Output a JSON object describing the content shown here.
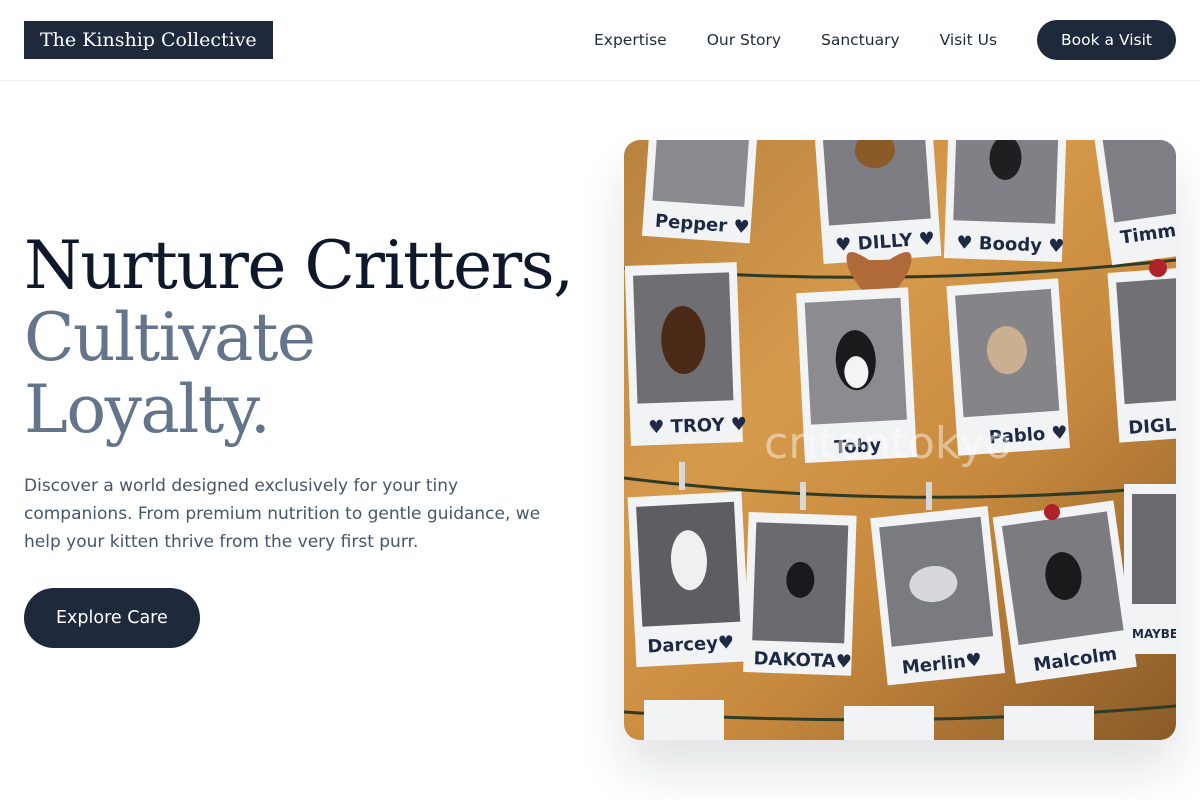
{
  "header": {
    "logo": "The Kinship Collective",
    "nav": [
      "Expertise",
      "Our Story",
      "Sanctuary",
      "Visit Us"
    ],
    "cta": "Book a Visit"
  },
  "hero": {
    "title_line1": "Nurture Critters,",
    "title_line2": "Cultivate",
    "title_line3": "Loyalty.",
    "description": "Discover a world designed exclusively for your tiny companions. From premium nutrition to gentle guidance, we help your kitten thrive from the very first purr.",
    "cta": "Explore Care",
    "image": {
      "watermark": "critentokyo",
      "photo_labels": [
        "Pepper ♥",
        "♥ DILLY ♥",
        "♥ Boody ♥",
        "Timm",
        "♥ TROY ♥",
        "Toby",
        "Pablo ♥",
        "DIGLE",
        "Darcey♥",
        "DAKOTA♥",
        "Merlin♥",
        "Malcolm",
        "MAYBELLE"
      ]
    }
  },
  "colors": {
    "primary": "#1e293b",
    "title_dark": "#0f172a",
    "title_muted": "#64748b",
    "body_text": "#475569"
  }
}
